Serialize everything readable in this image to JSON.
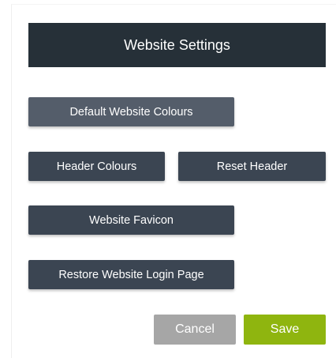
{
  "header": {
    "title": "Website Settings",
    "background_color": "#263038"
  },
  "buttons": {
    "default_colours": "Default Website Colours",
    "header_colours": "Header Colours",
    "reset_header": "Reset Header",
    "favicon": "Website Favicon",
    "restore_login": "Restore Website Login Page"
  },
  "footer": {
    "cancel_label": "Cancel",
    "save_label": "Save",
    "save_color": "#8fb50f",
    "cancel_color": "#a6a6a6"
  }
}
